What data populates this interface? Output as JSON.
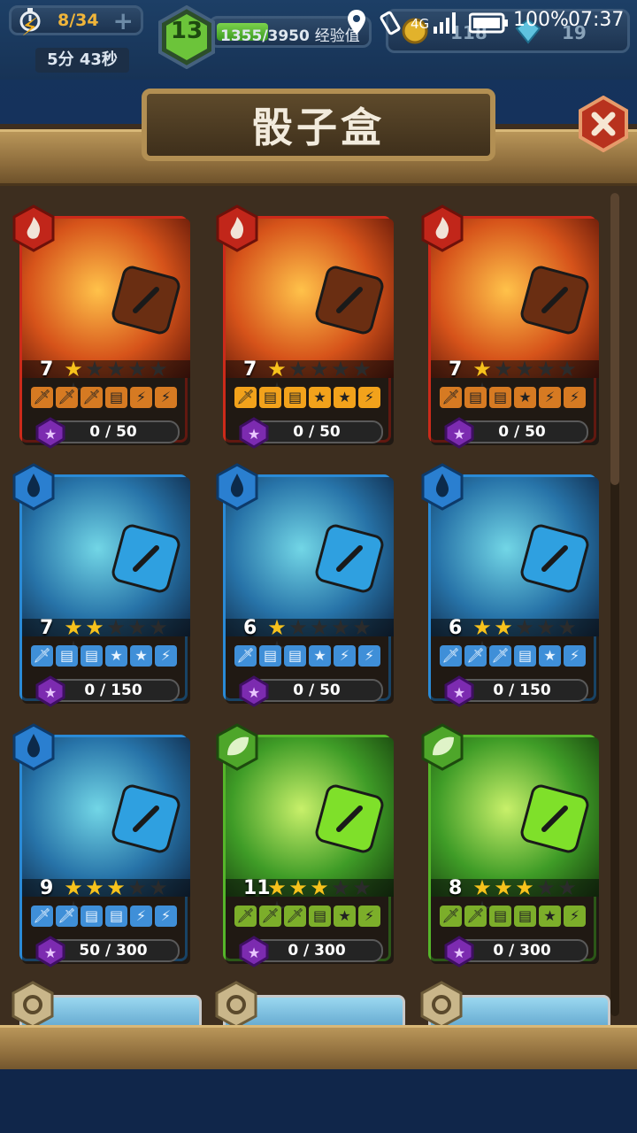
{
  "hud": {
    "energy": "8/34",
    "timer": "5分 43秒",
    "level": "13",
    "xp": "1355/3950",
    "xp_label": "经验值",
    "coins": "118",
    "gems": "19",
    "xp_progress": 0.343
  },
  "status_bar": {
    "network": "4G",
    "battery": "100%",
    "time": "07:37"
  },
  "title": "骰子盒",
  "cards": [
    {
      "element": "fire",
      "level": "7",
      "stars": 1,
      "faces": [
        "sword",
        "sword",
        "sword",
        "shield",
        "bolt",
        "bolt"
      ],
      "progress": "0 / 50",
      "variant": "normal"
    },
    {
      "element": "fire",
      "level": "7",
      "stars": 1,
      "faces": [
        "sword",
        "shield",
        "shield",
        "star",
        "star",
        "bolt"
      ],
      "progress": "0 / 50",
      "variant": "gold"
    },
    {
      "element": "fire",
      "level": "7",
      "stars": 1,
      "faces": [
        "sword",
        "shield",
        "shield",
        "star",
        "bolt",
        "bolt"
      ],
      "progress": "0 / 50",
      "variant": "normal"
    },
    {
      "element": "water",
      "level": "7",
      "stars": 2,
      "faces": [
        "sword",
        "shield",
        "shield",
        "star",
        "star",
        "bolt"
      ],
      "progress": "0 / 150",
      "variant": "normal"
    },
    {
      "element": "water",
      "level": "6",
      "stars": 1,
      "faces": [
        "sword",
        "shield",
        "shield",
        "star",
        "bolt",
        "bolt"
      ],
      "progress": "0 / 50",
      "variant": "normal"
    },
    {
      "element": "water",
      "level": "6",
      "stars": 2,
      "faces": [
        "sword",
        "sword",
        "sword",
        "shield",
        "star",
        "bolt"
      ],
      "progress": "0 / 150",
      "variant": "normal"
    },
    {
      "element": "water",
      "level": "9",
      "stars": 3,
      "faces": [
        "sword",
        "sword",
        "shield",
        "shield",
        "bolt",
        "bolt"
      ],
      "progress": "50 / 300",
      "variant": "normal"
    },
    {
      "element": "earth",
      "level": "11",
      "stars": 3,
      "faces": [
        "sword",
        "sword",
        "sword",
        "shield",
        "star",
        "bolt"
      ],
      "progress": "0 / 300",
      "variant": "normal"
    },
    {
      "element": "earth",
      "level": "8",
      "stars": 3,
      "faces": [
        "sword",
        "sword",
        "shield",
        "shield",
        "star",
        "bolt"
      ],
      "progress": "0 / 300",
      "variant": "normal"
    }
  ],
  "colors": {
    "fire": "#cc2a1a",
    "water": "#2a8ad6",
    "earth": "#55b62a",
    "star_on": "#f7c21c",
    "star_off": "#2b2b2b"
  }
}
